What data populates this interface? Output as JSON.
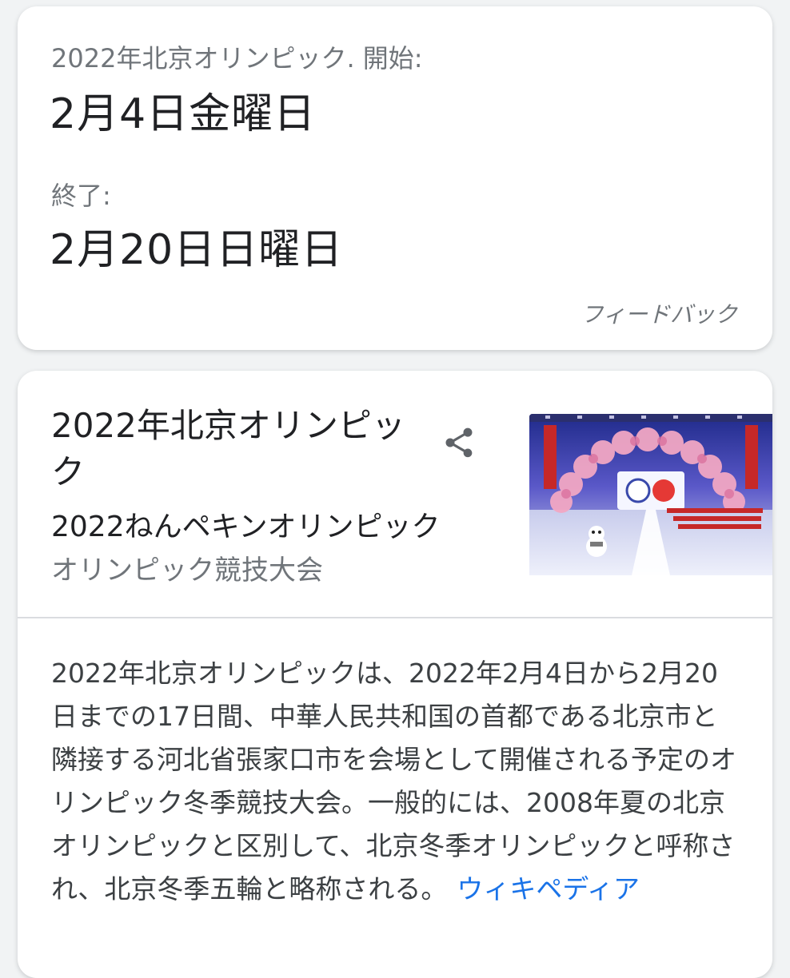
{
  "dates_card": {
    "start_label": "2022年北京オリンピック. 開始:",
    "start_date": "2月4日金曜日",
    "end_label": "終了:",
    "end_date": "2月20日日曜日",
    "feedback": "フィードバック"
  },
  "knowledge_panel": {
    "title": "2022年北京オリンピック",
    "reading": "2022ねんペキンオリンピック",
    "type": "オリンピック競技大会",
    "share_icon": "share-icon",
    "image_icon": "opening-ceremony-image",
    "description": "2022年北京オリンピックは、2022年2月4日から2月20日までの17日間、中華人民共和国の首都である北京市と隣接する河北省張家口市を会場として開催される予定のオリンピック冬季競技大会。一般的には、2008年夏の北京オリンピックと区別して、北京冬季オリンピックと呼称され、北京冬季五輪と略称される。",
    "source_link": "ウィキペディア"
  },
  "colors": {
    "link": "#1a73e8",
    "secondary_text": "#70757a",
    "primary_text": "#202124"
  }
}
